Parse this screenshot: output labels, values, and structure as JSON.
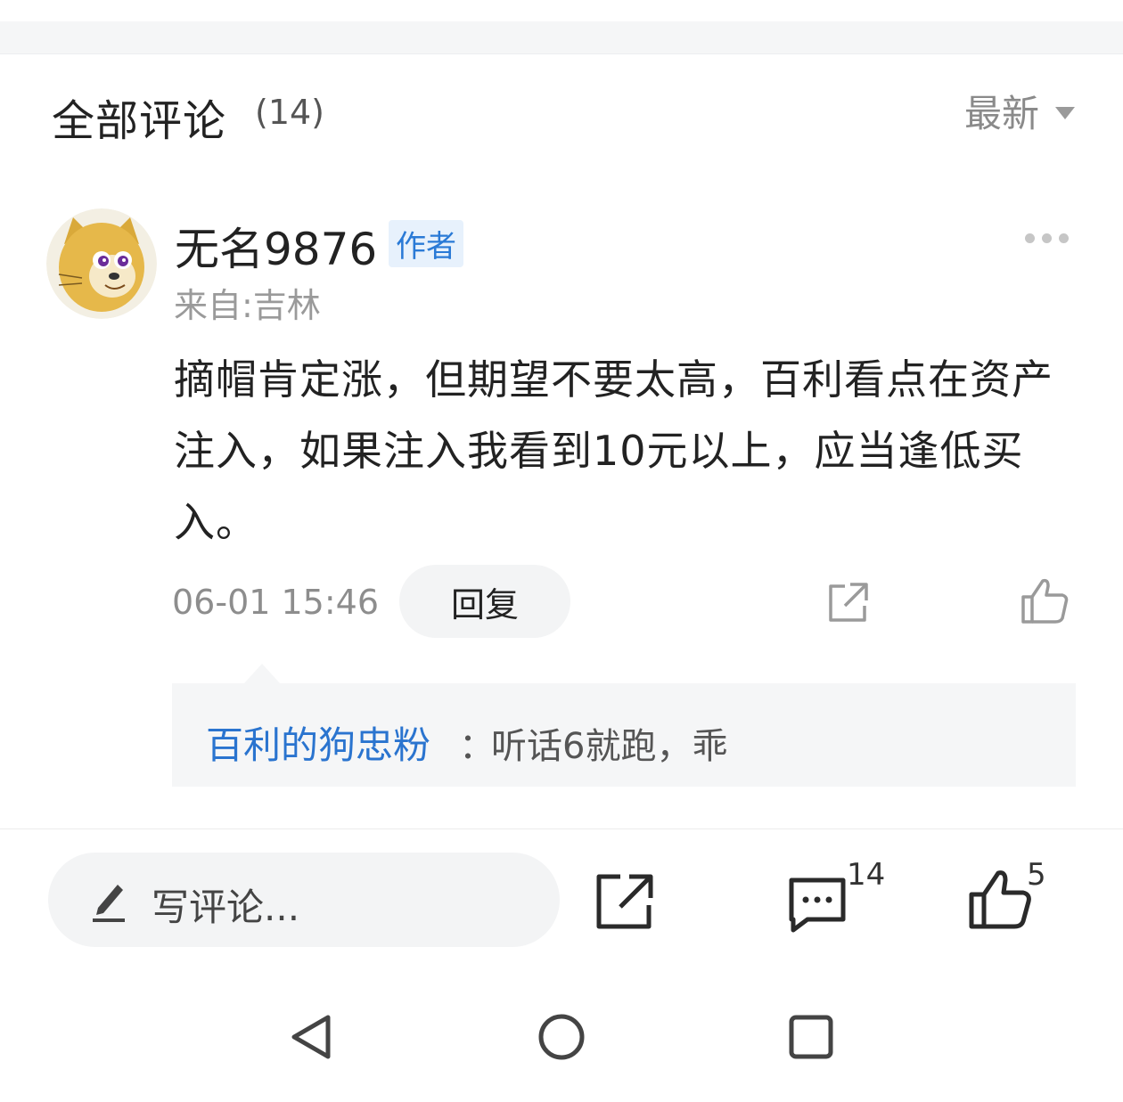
{
  "header": {
    "title": "全部评论",
    "count": "(14)",
    "sort_label": "最新"
  },
  "comment": {
    "username": "无名9876",
    "badge": "作者",
    "location": "来自:吉林",
    "content": "摘帽肯定涨，但期望不要太高，百利看点在资产注入，如果注入我看到10元以上，应当逢低买入。",
    "time": "06-01 15:46",
    "reply_label": "回复",
    "sub_reply": {
      "user": "百利的狗忠粉",
      "separator": "：",
      "text": "听话6就跑，乖"
    }
  },
  "bottom_bar": {
    "input_placeholder": "写评论...",
    "comment_count": "14",
    "like_count": "5"
  },
  "icons": {
    "sort": "triangle-down-icon",
    "more": "more-dots-icon",
    "share": "share-icon",
    "like": "thumbs-up-icon",
    "pencil": "pencil-icon",
    "comment": "comment-bubble-icon",
    "nav_back": "nav-back-icon",
    "nav_home": "nav-home-icon",
    "nav_recent": "nav-recent-icon"
  },
  "colors": {
    "link_blue": "#2a74cf",
    "badge_bg": "#e7f1fc",
    "muted_text": "#8d8d8d"
  }
}
